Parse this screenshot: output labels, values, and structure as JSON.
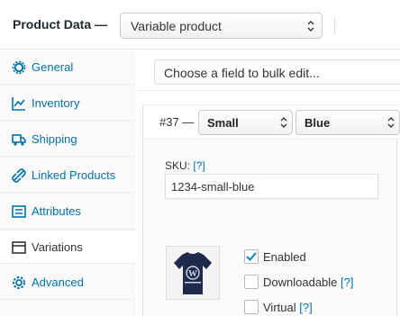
{
  "header": {
    "title": "Product Data —",
    "product_type": "Variable product"
  },
  "sidebar": {
    "items": [
      {
        "label": "General",
        "icon": "gear-icon"
      },
      {
        "label": "Inventory",
        "icon": "chart-icon"
      },
      {
        "label": "Shipping",
        "icon": "truck-icon"
      },
      {
        "label": "Linked Products",
        "icon": "link-icon"
      },
      {
        "label": "Attributes",
        "icon": "list-icon"
      },
      {
        "label": "Variations",
        "icon": "grid-icon",
        "active": true
      },
      {
        "label": "Advanced",
        "icon": "cog-icon"
      }
    ]
  },
  "main": {
    "bulk_edit_placeholder": "Choose a field to bulk edit...",
    "variation": {
      "number": "#37 —",
      "size": "Small",
      "color": "Blue",
      "sku_label": "SKU:",
      "sku_help": "[?]",
      "sku_value": "1234-small-blue",
      "checkboxes": [
        {
          "label": "Enabled",
          "help": "",
          "checked": true
        },
        {
          "label": "Downloadable",
          "help": "[?]",
          "checked": false
        },
        {
          "label": "Virtual",
          "help": "[?]",
          "checked": false
        }
      ]
    }
  },
  "colors": {
    "link": "#0073aa",
    "tshirt": "#1f2a4d"
  }
}
